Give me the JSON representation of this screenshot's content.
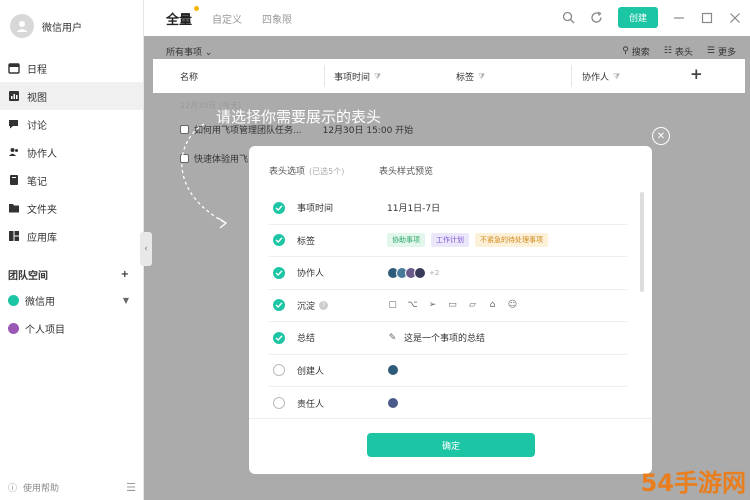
{
  "sidebar": {
    "user_name": "微信用户",
    "nav": [
      {
        "label": "日程",
        "icon": "calendar-icon",
        "active": false
      },
      {
        "label": "视图",
        "icon": "chart-icon",
        "active": true
      },
      {
        "label": "讨论",
        "icon": "chat-icon",
        "active": false
      },
      {
        "label": "协作人",
        "icon": "people-icon",
        "active": false
      },
      {
        "label": "笔记",
        "icon": "note-icon",
        "active": false
      },
      {
        "label": "文件夹",
        "icon": "folder-icon",
        "active": false
      },
      {
        "label": "应用库",
        "icon": "apps-icon",
        "active": false
      }
    ],
    "team_title": "团队空间",
    "team_add": "+",
    "team_items": [
      {
        "label": "微信用",
        "color": "#1cc5a4"
      },
      {
        "label": "个人项目",
        "color": "#9b59b6"
      }
    ],
    "help": "使用帮助"
  },
  "topbar": {
    "tabs": [
      "全量",
      "自定义",
      "四象限"
    ],
    "create": "创建"
  },
  "toolbar": {
    "filter": "所有事项",
    "search": "搜索",
    "header": "表头",
    "more": "更多"
  },
  "header_row": {
    "cols": [
      "名称",
      "事项时间",
      "标签",
      "协作人"
    ],
    "add": "+"
  },
  "list": {
    "date": "12月30日 (今天)",
    "item1": "如何用飞项管理团队任务...",
    "item1_time": "12月30日 15:00 开始",
    "item2": "快速体验用飞"
  },
  "hint": "请选择你需要展示的表头",
  "modal": {
    "col_opts": "表头选项",
    "selected": "(已选5个)",
    "col_preview": "表头样式预览",
    "options": [
      {
        "name": "事项时间",
        "checked": true,
        "preview": "11月1日-7日"
      },
      {
        "name": "标签",
        "checked": true,
        "tags": [
          {
            "text": "协助事项",
            "bg": "#e3f6ec",
            "fg": "#2aa866"
          },
          {
            "text": "工作计划",
            "bg": "#ece6fb",
            "fg": "#7a55d8"
          },
          {
            "text": "不紧急的待处理事项",
            "bg": "#fdf0d9",
            "fg": "#d08a1a"
          }
        ]
      },
      {
        "name": "协作人",
        "checked": true,
        "more": "+2"
      },
      {
        "name": "沉淀",
        "checked": true,
        "info": true
      },
      {
        "name": "总结",
        "checked": true,
        "preview": "这是一个事项的总结"
      },
      {
        "name": "创建人",
        "checked": false
      },
      {
        "name": "责任人",
        "checked": false
      }
    ],
    "ok": "确定"
  },
  "watermark": "54手游网"
}
